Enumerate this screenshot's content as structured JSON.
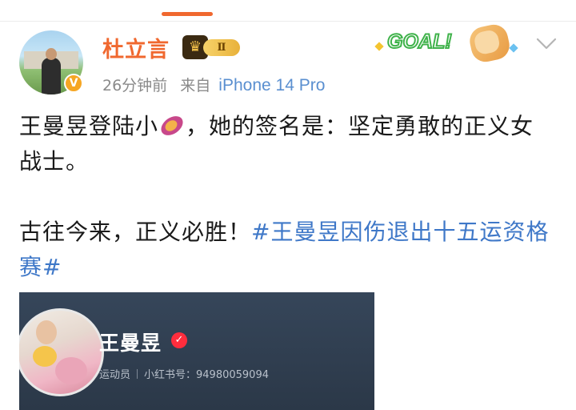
{
  "header": {
    "username": "杜立言",
    "vip_level": "Ⅱ",
    "time_ago": "26分钟前",
    "source_prefix": "来自",
    "device": "iPhone 14 Pro",
    "sticker_text": "GOAL!",
    "icons": [
      "verified-badge-icon",
      "vip-crown-icon",
      "chevron-down-icon"
    ]
  },
  "post": {
    "line1_before_emoji": "王曼昱登陆小",
    "line1_after_emoji": "，她的签名是：坚定勇敢的正义女战士。",
    "line2_plain": "古往今来，正义必胜！",
    "line2_hashtag": "#王曼昱因伤退出十五运资格赛#",
    "emoji_icon": "sweet-potato-icon"
  },
  "card": {
    "name": "王曼昱",
    "role": "运动员",
    "id_label": "小红书号：94980059094",
    "verified_icon": "red-check-icon"
  },
  "colors": {
    "accent": "#f0682f",
    "hashtag": "#3f78c8",
    "card_bg": "#36465a"
  }
}
